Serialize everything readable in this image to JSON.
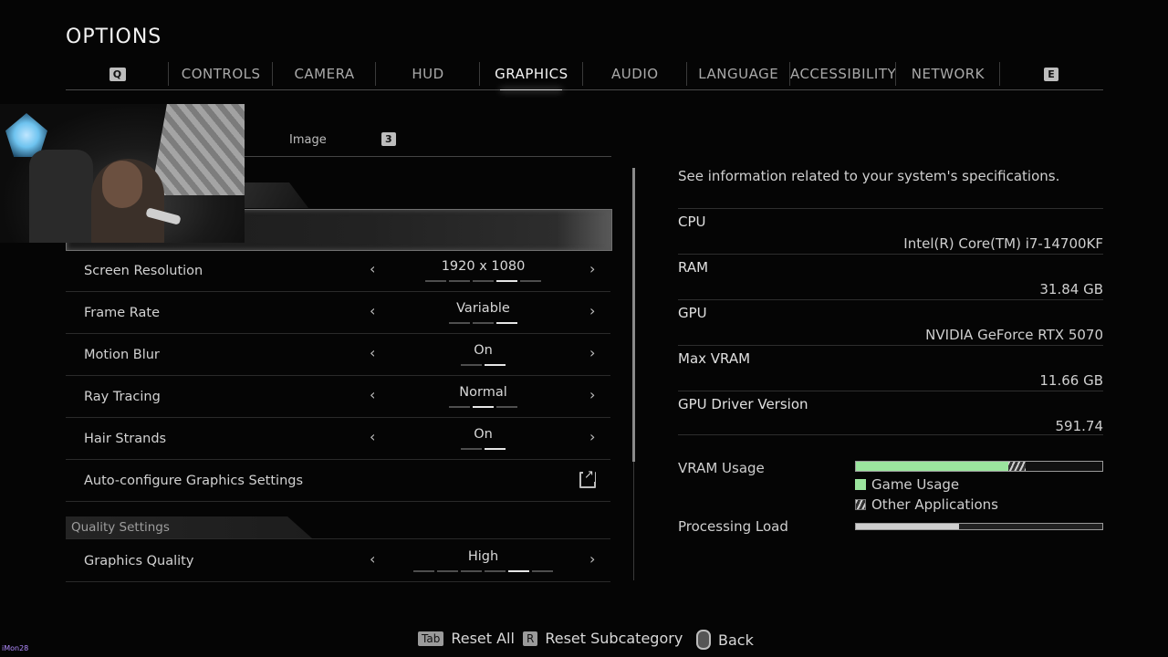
{
  "title": "OPTIONS",
  "tabs": {
    "left_key": "Q",
    "right_key": "E",
    "items": [
      "CONTROLS",
      "CAMERA",
      "HUD",
      "GRAPHICS",
      "AUDIO",
      "LANGUAGE",
      "ACCESSIBILITY",
      "NETWORK"
    ],
    "active": "GRAPHICS"
  },
  "subtab": {
    "label": "Image",
    "key": "3"
  },
  "settings": [
    {
      "label": "Screen Resolution",
      "value": "1920 x 1080",
      "pips_total": 5,
      "pip_active": 4
    },
    {
      "label": "Frame Rate",
      "value": "Variable",
      "pips_total": 3,
      "pip_active": 3
    },
    {
      "label": "Motion Blur",
      "value": "On",
      "pips_total": 2,
      "pip_active": 2
    },
    {
      "label": "Ray Tracing",
      "value": "Normal",
      "pips_total": 3,
      "pip_active": 2
    },
    {
      "label": "Hair Strands",
      "value": "On",
      "pips_total": 2,
      "pip_active": 2
    }
  ],
  "auto_config": {
    "label": "Auto-configure Graphics Settings",
    "icon": "external-link-icon"
  },
  "quality_section": {
    "header": "Quality Settings",
    "label": "Graphics Quality",
    "value": "High",
    "pips_total": 6,
    "pip_active": 5
  },
  "info": {
    "description": "See information related to your system's specifications.",
    "specs": [
      {
        "key": "CPU",
        "value": "Intel(R) Core(TM) i7-14700KF"
      },
      {
        "key": "RAM",
        "value": "31.84 GB"
      },
      {
        "key": "GPU",
        "value": "NVIDIA GeForce RTX 5070"
      },
      {
        "key": "Max VRAM",
        "value": "11.66 GB"
      },
      {
        "key": "GPU Driver Version",
        "value": "591.74"
      }
    ],
    "vram_label": "VRAM Usage",
    "vram_game_fraction": 0.62,
    "vram_other_fraction": 0.07,
    "legend_game": "Game Usage",
    "legend_other": "Other Applications",
    "load_label": "Processing Load",
    "load_fraction": 0.42,
    "colors": {
      "game": "#9be59e",
      "bar_border": "#9a9a9a"
    }
  },
  "footer": {
    "reset_all_key": "Tab",
    "reset_all": "Reset All",
    "reset_sub_key": "R",
    "reset_sub": "Reset Subcategory",
    "back_icon": "mouse-icon",
    "back": "Back"
  },
  "corner_tag": "iMon28"
}
